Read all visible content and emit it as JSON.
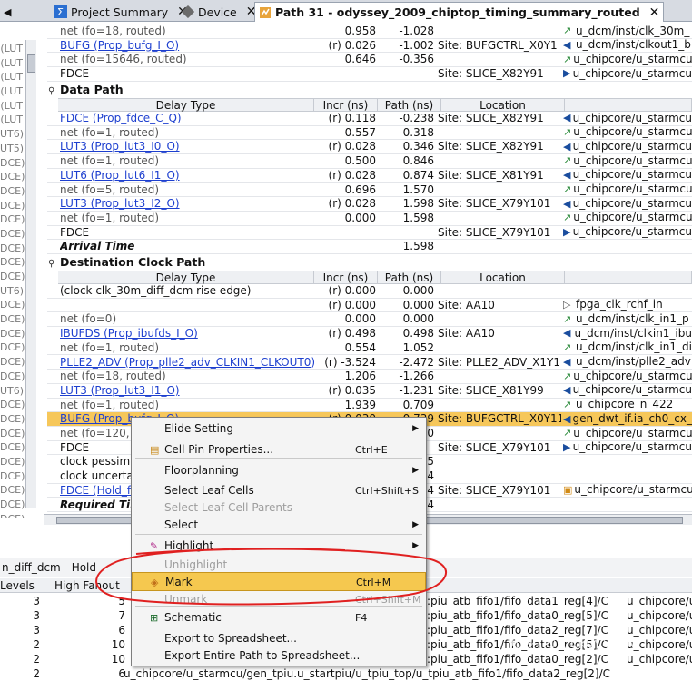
{
  "tabs": [
    {
      "label": "Project Summary",
      "active": false
    },
    {
      "label": "Device",
      "active": false
    },
    {
      "label": "Path 31 - odyssey_2009_chiptop_timing_summary_routed",
      "active": true
    }
  ],
  "left_strip": [
    "(LUT",
    "(LUT",
    "(LUT",
    "(LUT",
    "(LUT",
    "(LUT",
    "UT6)",
    "UT5)",
    "DCE)",
    "DCE)",
    "DCE)",
    "DCE)",
    "DCE)",
    "DCE)",
    "DCE)",
    "DCE)",
    "DCE)",
    "UT6)",
    "DCE)",
    "DCE)",
    "DCE)",
    "DCE)",
    "DCE)",
    "DCE)",
    "UT6)",
    "DCE)",
    "DCE)",
    "DCE)",
    "DCE)",
    "DCE)",
    "DCE)",
    "DCE)",
    "DCE)",
    "DCE)"
  ],
  "top_rows": [
    {
      "type": "net (fo=18, routed)",
      "kind": "net",
      "incr": "0.958",
      "path": "-1.028",
      "loc": "",
      "net": "u_dcm/inst/clk_30m_",
      "icon": "arrow"
    },
    {
      "type": "BUFG (Prop_bufg_I_O)",
      "kind": "link",
      "incr": "(r) 0.026",
      "path": "-1.002",
      "loc": "Site: BUFGCTRL_X0Y1",
      "net": "u_dcm/inst/clkout1_b",
      "icon": "cell"
    },
    {
      "type": "net (fo=15646, routed)",
      "kind": "net",
      "incr": "0.646",
      "path": "-0.356",
      "loc": "",
      "net": "u_chipcore/u_starmcu",
      "icon": "arrow"
    },
    {
      "type": "FDCE",
      "kind": "plain",
      "incr": "",
      "path": "",
      "loc": "Site: SLICE_X82Y91",
      "net": "u_chipcore/u_starmcu",
      "icon": "pin"
    }
  ],
  "data_path": {
    "title": "Data Path",
    "headers": {
      "delay_type": "Delay Type",
      "incr": "Incr (ns)",
      "path": "Path (ns)",
      "location": "Location"
    },
    "rows": [
      {
        "type": "FDCE (Prop_fdce_C_Q)",
        "kind": "link",
        "incr": "(r) 0.118",
        "path": "-0.238",
        "loc": "Site: SLICE_X82Y91",
        "net": "u_chipcore/u_starmcu",
        "icon": "cell"
      },
      {
        "type": "net (fo=1, routed)",
        "kind": "net",
        "incr": "0.557",
        "path": "0.318",
        "loc": "",
        "net": "u_chipcore/u_starmcu",
        "icon": "arrow"
      },
      {
        "type": "LUT3 (Prop_lut3_I0_O)",
        "kind": "link",
        "incr": "(r) 0.028",
        "path": "0.346",
        "loc": "Site: SLICE_X82Y91",
        "net": "u_chipcore/u_starmcu",
        "icon": "cell"
      },
      {
        "type": "net (fo=1, routed)",
        "kind": "net",
        "incr": "0.500",
        "path": "0.846",
        "loc": "",
        "net": "u_chipcore/u_starmcu",
        "icon": "arrow"
      },
      {
        "type": "LUT6 (Prop_lut6_I1_O)",
        "kind": "link",
        "incr": "(r) 0.028",
        "path": "0.874",
        "loc": "Site: SLICE_X81Y91",
        "net": "u_chipcore/u_starmcu",
        "icon": "cell"
      },
      {
        "type": "net (fo=5, routed)",
        "kind": "net",
        "incr": "0.696",
        "path": "1.570",
        "loc": "",
        "net": "u_chipcore/u_starmcu",
        "icon": "arrow"
      },
      {
        "type": "LUT3 (Prop_lut3_I2_O)",
        "kind": "link",
        "incr": "(r) 0.028",
        "path": "1.598",
        "loc": "Site: SLICE_X79Y101",
        "net": "u_chipcore/u_starmcu",
        "icon": "cell"
      },
      {
        "type": "net (fo=1, routed)",
        "kind": "net",
        "incr": "0.000",
        "path": "1.598",
        "loc": "",
        "net": "u_chipcore/u_starmcu",
        "icon": "arrow"
      },
      {
        "type": "FDCE",
        "kind": "plain",
        "incr": "",
        "path": "",
        "loc": "Site: SLICE_X79Y101",
        "net": "u_chipcore/u_starmcu",
        "icon": "pin"
      },
      {
        "type": "Arrival Time",
        "kind": "bold",
        "incr": "",
        "path": "1.598",
        "loc": "",
        "net": "",
        "icon": ""
      }
    ]
  },
  "dest_path": {
    "title": "Destination Clock Path",
    "headers": {
      "delay_type": "Delay Type",
      "incr": "Incr (ns)",
      "path": "Path (ns)",
      "location": "Location"
    },
    "rows": [
      {
        "type": "(clock clk_30m_diff_dcm rise edge)",
        "kind": "plain",
        "incr": "(r) 0.000",
        "path": "0.000",
        "loc": "",
        "net": "",
        "icon": ""
      },
      {
        "type": "",
        "kind": "plain",
        "incr": "(r) 0.000",
        "path": "0.000",
        "loc": "Site: AA10",
        "net": "fpga_clk_rchf_in",
        "icon": "port"
      },
      {
        "type": "net (fo=0)",
        "kind": "net",
        "incr": "0.000",
        "path": "0.000",
        "loc": "",
        "net": "u_dcm/inst/clk_in1_p",
        "icon": "arrow"
      },
      {
        "type": "IBUFDS (Prop_ibufds_I_O)",
        "kind": "link",
        "incr": "(r) 0.498",
        "path": "0.498",
        "loc": "Site: AA10",
        "net": "u_dcm/inst/clkin1_ibu",
        "icon": "cell"
      },
      {
        "type": "net (fo=1, routed)",
        "kind": "net",
        "incr": "0.554",
        "path": "1.052",
        "loc": "",
        "net": "u_dcm/inst/clk_in1_di",
        "icon": "arrow"
      },
      {
        "type": "PLLE2_ADV (Prop_plle2_adv_CLKIN1_CLKOUT0)",
        "kind": "link",
        "incr": "(r) -3.524",
        "path": "-2.472",
        "loc": "Site: PLLE2_ADV_X1Y1",
        "net": "u_dcm/inst/plle2_adv",
        "icon": "cell"
      },
      {
        "type": "net (fo=18, routed)",
        "kind": "net",
        "incr": "1.206",
        "path": "-1.266",
        "loc": "",
        "net": "u_chipcore/u_starmcu",
        "icon": "arrow"
      },
      {
        "type": "LUT3 (Prop_lut3_I1_O)",
        "kind": "link",
        "incr": "(r) 0.035",
        "path": "-1.231",
        "loc": "Site: SLICE_X81Y99",
        "net": "u_chipcore/u_starmcu",
        "icon": "cell"
      },
      {
        "type": "net (fo=1, routed)",
        "kind": "net",
        "incr": "1.939",
        "path": "0.709",
        "loc": "",
        "net": "u_chipcore_n_422",
        "icon": "arrow"
      },
      {
        "type": "BUFG (Prop_bufg_I_O)",
        "kind": "link-hl",
        "incr": "(r) 0.030",
        "path": "0.739",
        "loc": "Site: BUFGCTRL_X0Y11",
        "net": "gen_dwt_if.ia_ch0_cx_",
        "icon": "cell"
      },
      {
        "type": "net (fo=120, routed)",
        "kind": "net",
        "incr": "",
        "path": "0",
        "loc": "",
        "net": "u_chipcore/u_starmcu",
        "icon": "arrow"
      },
      {
        "type": "FDCE",
        "kind": "plain",
        "incr": "",
        "path": "",
        "loc": "Site: SLICE_X79Y101",
        "net": "u_chipcore/u_starmcu",
        "icon": "pin"
      },
      {
        "type": "clock pessimism",
        "kind": "plain",
        "incr": "",
        "path": "5",
        "loc": "",
        "net": "",
        "icon": ""
      },
      {
        "type": "clock uncertainty",
        "kind": "plain",
        "incr": "",
        "path": "4",
        "loc": "",
        "net": "",
        "icon": ""
      },
      {
        "type": "FDCE (Hold_fdce_C_CLR)",
        "kind": "link",
        "incr": "",
        "path": "4",
        "loc": "Site: SLICE_X79Y101",
        "net": "u_chipcore/u_starmcu",
        "icon": "lock"
      },
      {
        "type": "Required Time",
        "kind": "bold",
        "incr": "",
        "path": "4",
        "loc": "",
        "net": "",
        "icon": ""
      }
    ]
  },
  "bottom_panel": {
    "title": "n_diff_dcm - Hold",
    "headers": {
      "levels": "Levels",
      "fanout": "High Fanout"
    },
    "rows": [
      {
        "levels": "3",
        "fanout": "5",
        "path": ":piu_atb_fifo1/fifo_data1_reg[4]/C",
        "dest": "u_chipcore/u"
      },
      {
        "levels": "3",
        "fanout": "7",
        "path": ":piu_atb_fifo1/fifo_data0_reg[5]/C",
        "dest": "u_chipcore/u"
      },
      {
        "levels": "3",
        "fanout": "6",
        "path": ":piu_atb_fifo1/fifo_data2_reg[7]/C",
        "dest": "u_chipcore/u"
      },
      {
        "levels": "2",
        "fanout": "10",
        "path": ":piu_atb_fifo1/fifo_data0_reg[5]/C",
        "dest": "u_chipcore/u"
      },
      {
        "levels": "2",
        "fanout": "10",
        "path": ":piu_atb_fifo1/fifo_data0_reg[2]/C",
        "dest": "u_chipcore/u"
      },
      {
        "levels": "2",
        "fanout": "6",
        "path": "u_chipcore/u_starmcu/gen_tpiu.u_startpiu/u_tpiu_top/u_tpiu_atb_fifo1/fifo_data2_reg[2]/C",
        "dest": ""
      }
    ]
  },
  "context_menu": {
    "items": [
      {
        "label": "Elide Setting",
        "shortcut": "",
        "submenu": true,
        "disabled": false,
        "icon": ""
      },
      {
        "label": "Cell Pin Properties...",
        "shortcut": "Ctrl+E",
        "submenu": false,
        "disabled": false,
        "icon": "props"
      },
      {
        "label": "Floorplanning",
        "shortcut": "",
        "submenu": true,
        "disabled": false,
        "icon": ""
      },
      {
        "label": "Select Leaf Cells",
        "shortcut": "Ctrl+Shift+S",
        "submenu": false,
        "disabled": false,
        "icon": ""
      },
      {
        "label": "Select Leaf Cell Parents",
        "shortcut": "",
        "submenu": false,
        "disabled": true,
        "icon": ""
      },
      {
        "label": "Select",
        "shortcut": "",
        "submenu": true,
        "disabled": false,
        "icon": ""
      },
      {
        "label": "Highlight",
        "shortcut": "",
        "submenu": true,
        "disabled": false,
        "icon": "highlight"
      },
      {
        "label": "Unhighlight",
        "shortcut": "",
        "submenu": false,
        "disabled": true,
        "icon": ""
      },
      {
        "label": "Mark",
        "shortcut": "Ctrl+M",
        "submenu": false,
        "disabled": false,
        "icon": "mark",
        "active": true
      },
      {
        "label": "Unmark",
        "shortcut": "Ctrl+Shift+M",
        "submenu": false,
        "disabled": true,
        "icon": ""
      },
      {
        "label": "Schematic",
        "shortcut": "F4",
        "submenu": false,
        "disabled": false,
        "icon": "schematic"
      },
      {
        "label": "Export to Spreadsheet...",
        "shortcut": "",
        "submenu": false,
        "disabled": false,
        "icon": ""
      },
      {
        "label": "Export Entire Path to Spreadsheet...",
        "shortcut": "",
        "submenu": false,
        "disabled": false,
        "icon": ""
      }
    ]
  },
  "watermark": "知乎 @luckyyyyyy",
  "colors": {
    "link": "#1d3fcf",
    "highlight_row": "#f6c75a",
    "menu_active": "#f5c84f",
    "annotation": "#e02020"
  }
}
